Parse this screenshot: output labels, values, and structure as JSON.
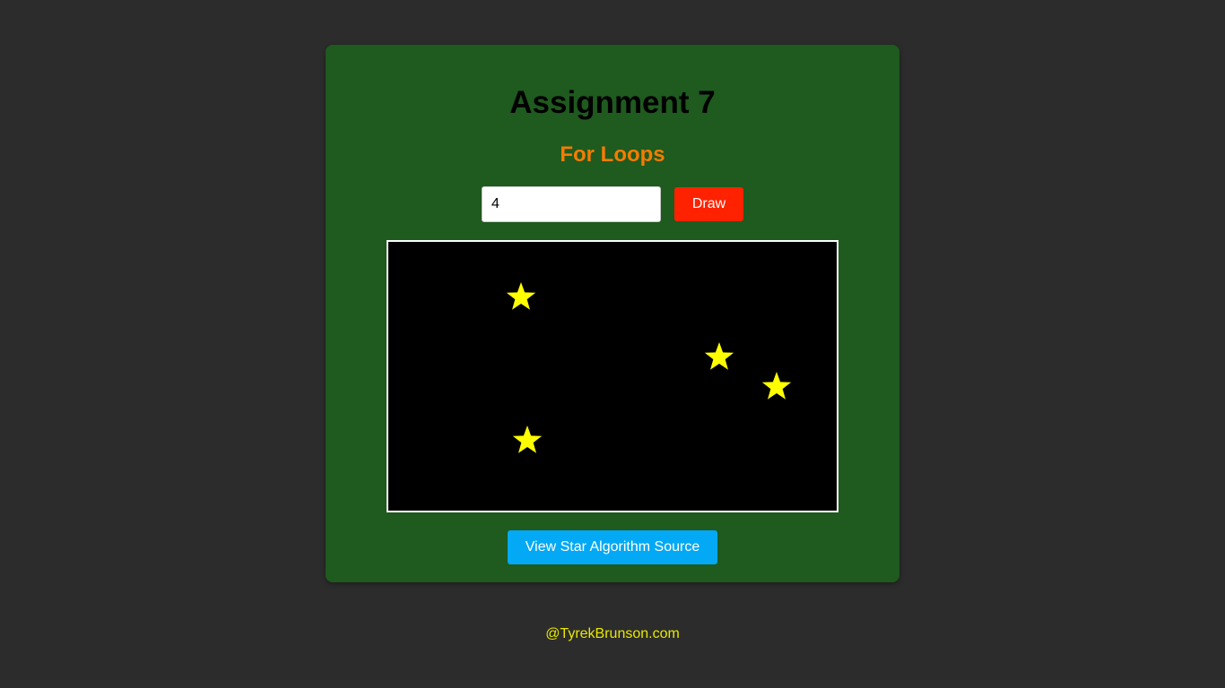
{
  "page": {
    "title": "Assignment 7",
    "subtitle": "For Loops"
  },
  "controls": {
    "star_count_value": "4",
    "draw_label": "Draw",
    "source_label": "View Star Algorithm Source"
  },
  "stars": {
    "count": 4,
    "color": "#ffff00",
    "icon": "star-icon"
  },
  "footer": {
    "credit": "@TyrekBrunson.com"
  },
  "colors": {
    "background": "#2c2c2c",
    "card": "#1f5a1e",
    "subtitle": "#f57c00",
    "draw_button": "#ff2200",
    "source_button": "#03a9f4",
    "canvas": "#000000",
    "footer": "#e8e800"
  }
}
